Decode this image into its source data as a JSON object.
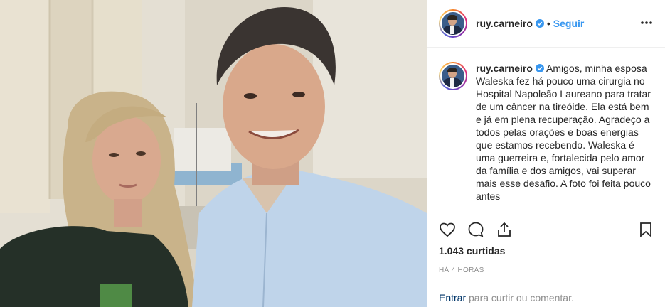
{
  "post": {
    "username": "ruy.carneiro",
    "separator": "•",
    "follow_label": "Seguir",
    "caption": "Amigos, minha esposa Waleska fez há pouco uma cirurgia no Hospital Napoleão Laureano para tratar de um câncer na tireóide. Ela está bem e já em plena recuperação. Agradeço a todos pelas orações e boas energias que estamos recebendo. Waleska é uma guerreira e, fortalecida pelo amor da família e dos amigos, vai superar mais esse desafio. A foto foi feita pouco antes",
    "likes": "1.043 curtidas",
    "time": "HÁ 4 HORAS",
    "login_link": "Entrar",
    "login_suffix": " para curtir ou comentar."
  },
  "icons": {
    "verified": "verified-badge-icon",
    "more": "more-options-icon",
    "like": "heart-icon",
    "comment": "comment-icon",
    "share": "share-icon",
    "save": "bookmark-icon"
  },
  "colors": {
    "accent": "#3897f0",
    "link": "#003569",
    "muted": "#8e8e8e",
    "border": "#efefef"
  }
}
